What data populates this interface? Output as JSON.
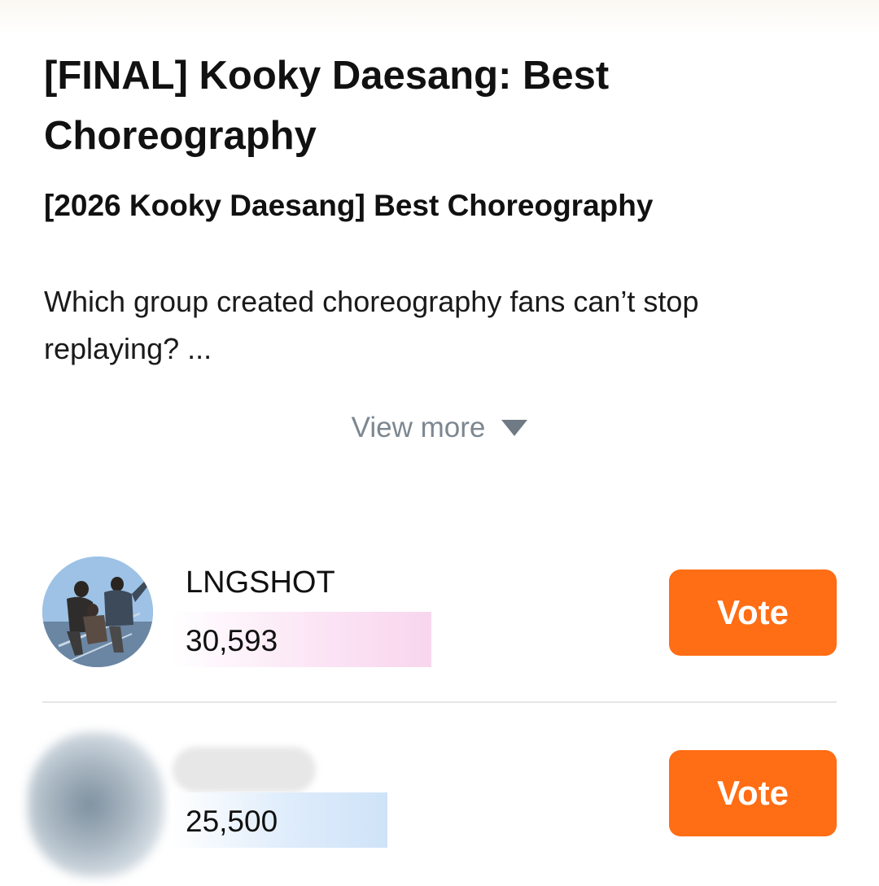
{
  "poll": {
    "title": "[FINAL] Kooky Daesang: Best Choreography",
    "subtitle": "[2026 Kooky Daesang] Best Choreography",
    "description": "Which group created choreography fans can’t stop replaying? ...",
    "view_more_label": "View more"
  },
  "candidates": [
    {
      "name": "LNGSHOT",
      "votes": "30,593",
      "vote_label": "Vote",
      "bar_color": "#f8d6ee",
      "name_obscured": false
    },
    {
      "name": "",
      "votes": "25,500",
      "vote_label": "Vote",
      "bar_color": "#cfe3f8",
      "name_obscured": true
    }
  ],
  "colors": {
    "accent": "#ff6d14",
    "muted_text": "#7c8791",
    "divider": "#e6e6e6"
  },
  "icons": {
    "view_more": "triangle-down-icon"
  }
}
